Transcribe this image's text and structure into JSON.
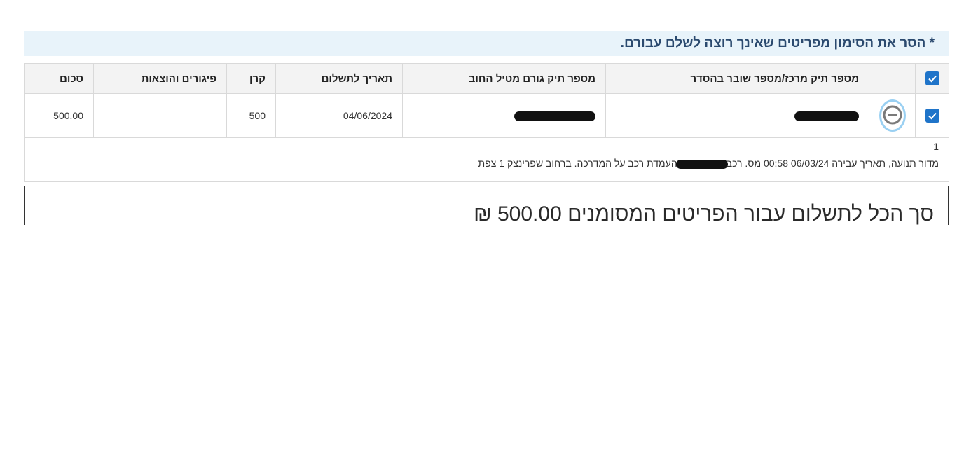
{
  "notice": {
    "text": "* הסר את הסימון מפריטים שאינך רוצה לשלם עבורם."
  },
  "table": {
    "headers": {
      "central_file": "מספר תיק מרכז/מספר שובר בהסדר",
      "debt_file": "מספר תיק גורם מטיל החוב",
      "due_date": "תאריך לתשלום",
      "principal": "קרן",
      "fees": "פיגורים והוצאות",
      "amount": "סכום"
    },
    "rows": [
      {
        "checked": true,
        "central_file": "",
        "debt_file": "",
        "due_date": "04/06/2024",
        "principal": "500",
        "fees": "",
        "amount": "500.00"
      }
    ],
    "details": {
      "number": "1",
      "text_before": "מדור תנועה, תאריך עבירה 06/03/24 00:58 מס. רכב",
      "text_after": "העמדת רכב על המדרכה. ברחוב שפרינצק 1 צפת"
    }
  },
  "total": {
    "label": "סך הכל לתשלום עבור הפריטים המסומנים",
    "amount": "500.00",
    "currency": "₪"
  },
  "icons": {
    "select_all": "checkbox-checked-icon",
    "row_select": "checkbox-checked-icon",
    "remove": "minus-circle-icon"
  },
  "colors": {
    "notice_bg": "#e8f3fa",
    "notice_text": "#2b4a6f",
    "checkbox": "#1f74c9",
    "remove_ring": "#9ad0f2"
  }
}
